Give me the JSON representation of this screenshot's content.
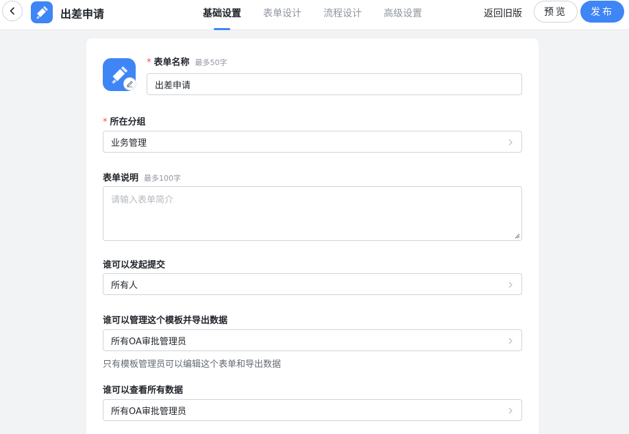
{
  "header": {
    "title": "出差申请",
    "tabs": [
      {
        "label": "基础设置",
        "active": true
      },
      {
        "label": "表单设计",
        "active": false
      },
      {
        "label": "流程设计",
        "active": false
      },
      {
        "label": "高级设置",
        "active": false
      }
    ],
    "old_version_label": "返回旧版",
    "preview_label": "预览",
    "publish_label": "发布"
  },
  "form": {
    "name": {
      "label": "表单名称",
      "required_mark": "*",
      "hint": "最多50字",
      "value": "出差申请"
    },
    "group": {
      "label": "所在分组",
      "required_mark": "*",
      "value": "业务管理"
    },
    "description": {
      "label": "表单说明",
      "hint": "最多100字",
      "placeholder": "请输入表单简介"
    },
    "submitters": {
      "label": "谁可以发起提交",
      "value": "所有人"
    },
    "managers": {
      "label": "谁可以管理这个模板并导出数据",
      "value": "所有OA审批管理员",
      "helper": "只有模板管理员可以编辑这个表单和导出数据"
    },
    "viewers": {
      "label": "谁可以查看所有数据",
      "value": "所有OA审批管理员"
    }
  },
  "icons": {
    "back": "chevron-left-icon",
    "app": "pen-icon",
    "edit": "pencil-icon",
    "select_arrow": "chevron-right-icon"
  },
  "colors": {
    "accent": "#3e85f6",
    "required": "#f54a45",
    "background": "#f2f3f5"
  }
}
